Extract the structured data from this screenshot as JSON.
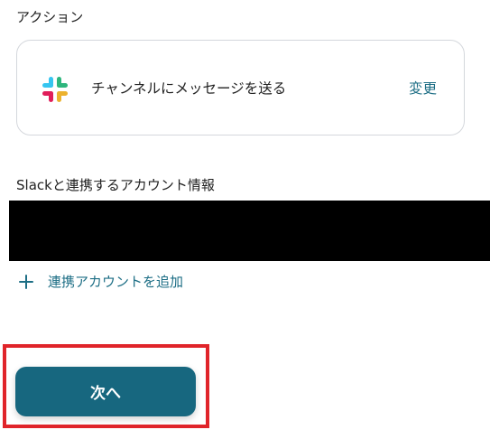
{
  "action_section": {
    "label": "アクション",
    "app_icon": "slack-icon",
    "action_name": "チャンネルにメッセージを送る",
    "change_label": "変更"
  },
  "account_section": {
    "label": "Slackと連携するアカウント情報",
    "account_value_redacted": true,
    "add_account_icon": "plus-icon",
    "add_account_label": "連携アカウントを追加"
  },
  "footer": {
    "next_label": "次へ",
    "highlight_color": "#e0242a"
  },
  "colors": {
    "accent": "#1d6e85",
    "button_bg": "#17677f",
    "card_border": "#d4d7dc"
  }
}
